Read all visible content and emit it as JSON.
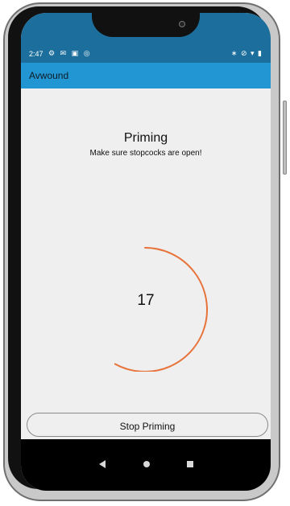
{
  "status": {
    "time": "2:47",
    "left_icons": [
      "settings-icon",
      "mail-icon",
      "image-icon",
      "sync-icon"
    ],
    "right_icons": [
      "bluetooth-icon",
      "mute-icon",
      "wifi-icon",
      "battery-icon"
    ]
  },
  "app": {
    "title": "Avwound"
  },
  "priming": {
    "heading": "Priming",
    "subheading": "Make sure stopcocks are open!",
    "counter": "17",
    "progress_fraction": 0.58
  },
  "actions": {
    "stop_label": "Stop Priming"
  },
  "colors": {
    "status_bar": "#1c6f9c",
    "app_bar": "#2196d3",
    "progress": "#e8733a",
    "background": "#efefef"
  },
  "nav": {
    "buttons": [
      "back-icon",
      "home-icon",
      "recent-apps-icon"
    ]
  }
}
